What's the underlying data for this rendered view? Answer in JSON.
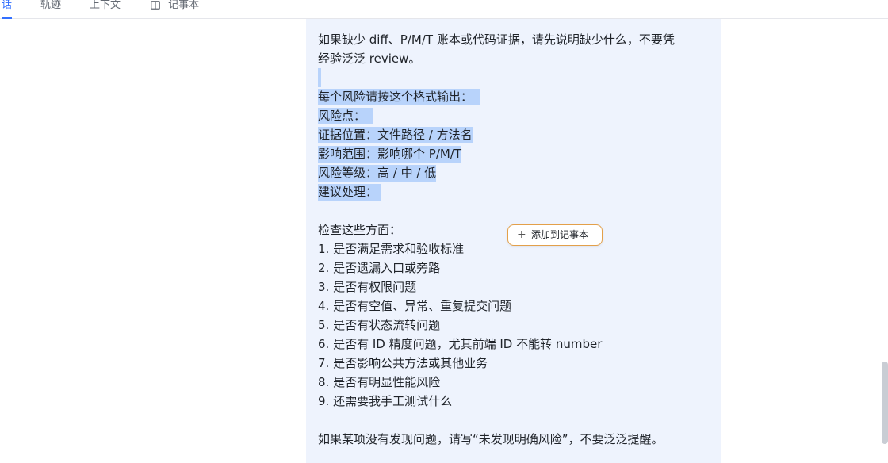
{
  "tabs": [
    {
      "label": "话",
      "active": true
    },
    {
      "label": "轨迹",
      "active": false
    },
    {
      "label": "上下文",
      "active": false
    },
    {
      "label": "记事本",
      "active": false,
      "icon": "book-icon"
    }
  ],
  "message": {
    "line1": "如果缺少 diff、P/M/T 账本或代码证据，请先说明缺少什么，不要凭",
    "line2": "经验泛泛 review。",
    "format_intro": "每个风险请按这个格式输出：",
    "field_risk": "风险点：",
    "field_evidence": "证据位置：文件路径 / 方法名",
    "field_scope": "影响范围：影响哪个 P/M/T",
    "field_level": "风险等级：高 / 中 / 低",
    "field_action": "建议处理：",
    "check_intro": "检查这些方面：",
    "checks": [
      "1. 是否满足需求和验收标准",
      "2. 是否遗漏入口或旁路",
      "3. 是否有权限问题",
      "4. 是否有空值、异常、重复提交问题",
      "5. 是否有状态流转问题",
      "6. 是否有 ID 精度问题，尤其前端 ID 不能转 number",
      "7. 是否影响公共方法或其他业务",
      "8. 是否有明显性能风险",
      "9. 还需要我手工测试什么"
    ],
    "footer": "如果某项没有发现问题，请写“未发现明确风险”，不要泛泛提醒。"
  },
  "add_to_notebook": {
    "label": "添加到记事本",
    "icon": "plus-icon"
  },
  "colors": {
    "accent": "#3370ff",
    "bubble": "#eef3fd",
    "selection": "#b8d3fb",
    "button_border": "#e3a04a"
  }
}
